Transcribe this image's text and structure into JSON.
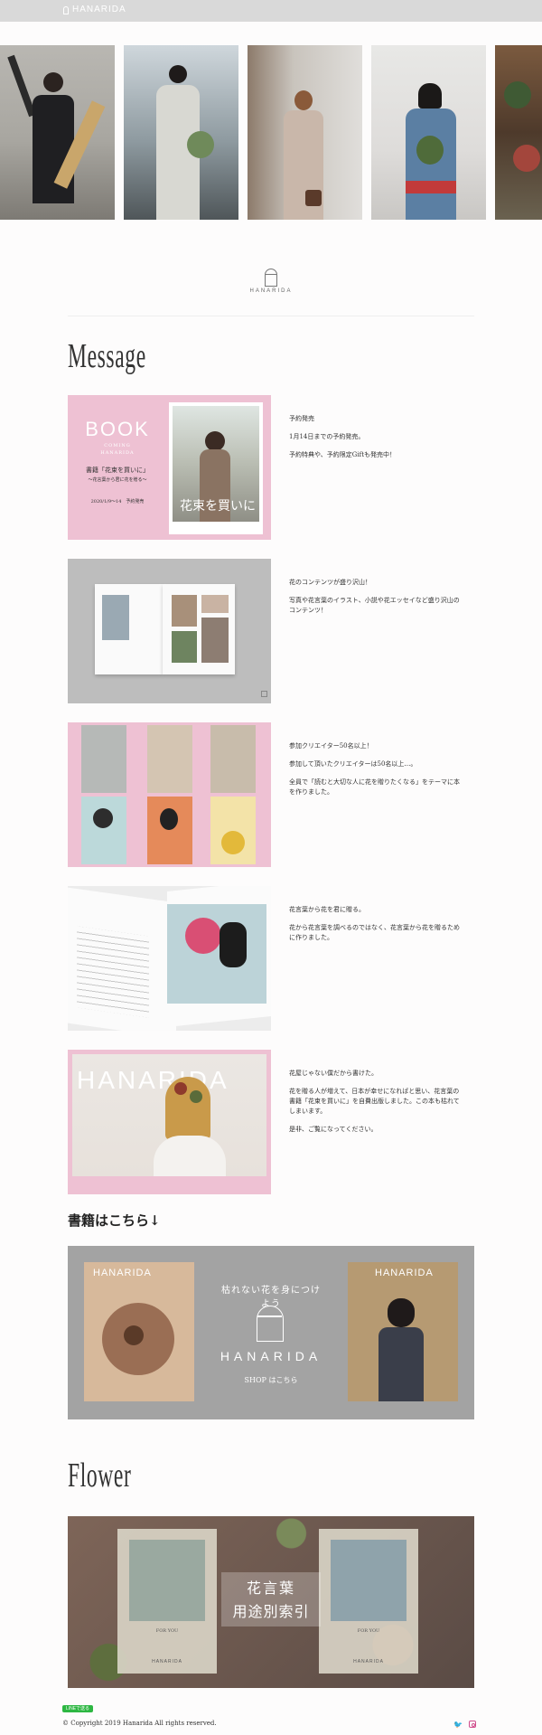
{
  "header": {
    "brand": "HANARIDA"
  },
  "hero": {
    "photos": [
      "hero-photo-1",
      "hero-photo-2",
      "hero-photo-3",
      "hero-photo-4",
      "hero-photo-5"
    ]
  },
  "logo": {
    "wordmark": "HANARIDA"
  },
  "message": {
    "title": "Message",
    "items": [
      {
        "image": {
          "book_label": "BOOK",
          "coming_label": "COMING",
          "brand": "HANARIDA",
          "book_title": "書籍「花束を買いに」",
          "book_subtitle": "〜花言葉から君に花を贈る〜",
          "release": "2020/1/9〜14　予約発売",
          "cover_text": "花束を買いに"
        },
        "lines": [
          "予約発売",
          "1月14日までの予約発売。",
          "予約特典や、予約限定Giftも発売中！"
        ]
      },
      {
        "lines": [
          "花のコンテンツが盛り沢山！",
          "写真や花言葉のイラスト、小説や花エッセイなど盛り沢山のコンテンツ！"
        ]
      },
      {
        "lines": [
          "参加クリエイター50名以上！",
          "参加して頂いたクリエイターは50名以上…。",
          "全員で「読むと大切な人に花を贈りたくなる」をテーマに本を作りました。"
        ]
      },
      {
        "lines": [
          "花言葉から花を君に贈る。",
          "花から花言葉を調べるのではなく、花言葉から花を贈るために作りました。"
        ]
      },
      {
        "image": {
          "wordmark": "HANARIDA"
        },
        "lines": [
          "花屋じゃない僕だから書けた。",
          "花を贈る人が増えて、日本が幸せになればと思い、花言葉の書籍「花束を買いに」を自費出版しました。この本も枯れてしまいます。",
          "是非、ご覧になってください。"
        ]
      }
    ]
  },
  "books": {
    "heading": "書籍はこちら↓",
    "banner": {
      "card_brand": "HANARIDA",
      "tagline": "枯れない花を身につけよう",
      "wordmark": "HANARIDA",
      "shop_label": "SHOP はこちら"
    }
  },
  "flower": {
    "title": "Flower",
    "image": {
      "index_line1": "花言葉",
      "index_line2": "用途別索引",
      "card_label": "FOR YOU",
      "card_brand": "HANARIDA"
    }
  },
  "footer": {
    "line_badge": "LINEで送る",
    "copyright": "© Copyright 2019 Hanarida All rights reserved.",
    "social": [
      "twitter-icon",
      "instagram-icon"
    ]
  },
  "colors": {
    "pink": "#eec1d3",
    "gray": "#a3a3a3",
    "topbar": "#d9d9d9"
  }
}
